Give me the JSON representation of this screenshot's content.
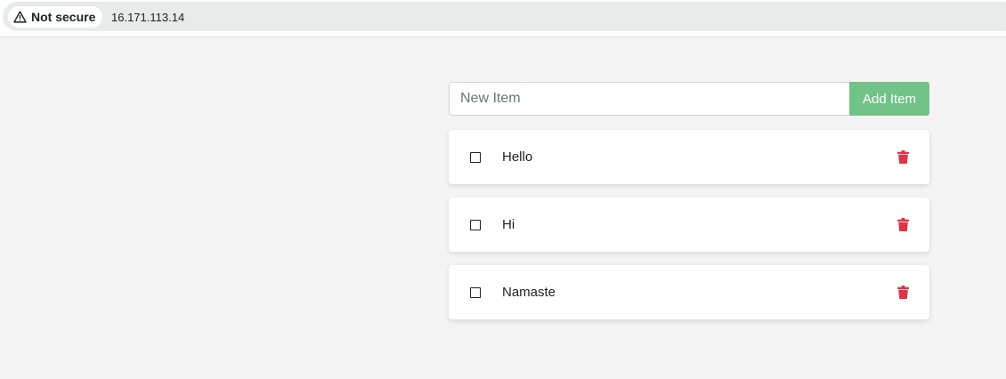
{
  "browser": {
    "security_label": "Not secure",
    "security_icon": "warning-triangle-icon",
    "url": "16.171.113.14"
  },
  "form": {
    "input_placeholder": "New Item",
    "input_value": "",
    "add_button_label": "Add Item"
  },
  "items": [
    {
      "text": "Hello",
      "checked": false
    },
    {
      "text": "Hi",
      "checked": false
    },
    {
      "text": "Namaste",
      "checked": false
    }
  ],
  "icons": {
    "checkbox": "square-checkbox-icon",
    "delete": "trash-icon"
  },
  "colors": {
    "accent": "#72c387",
    "delete": "#dc3545",
    "background": "#f4f4f4"
  }
}
